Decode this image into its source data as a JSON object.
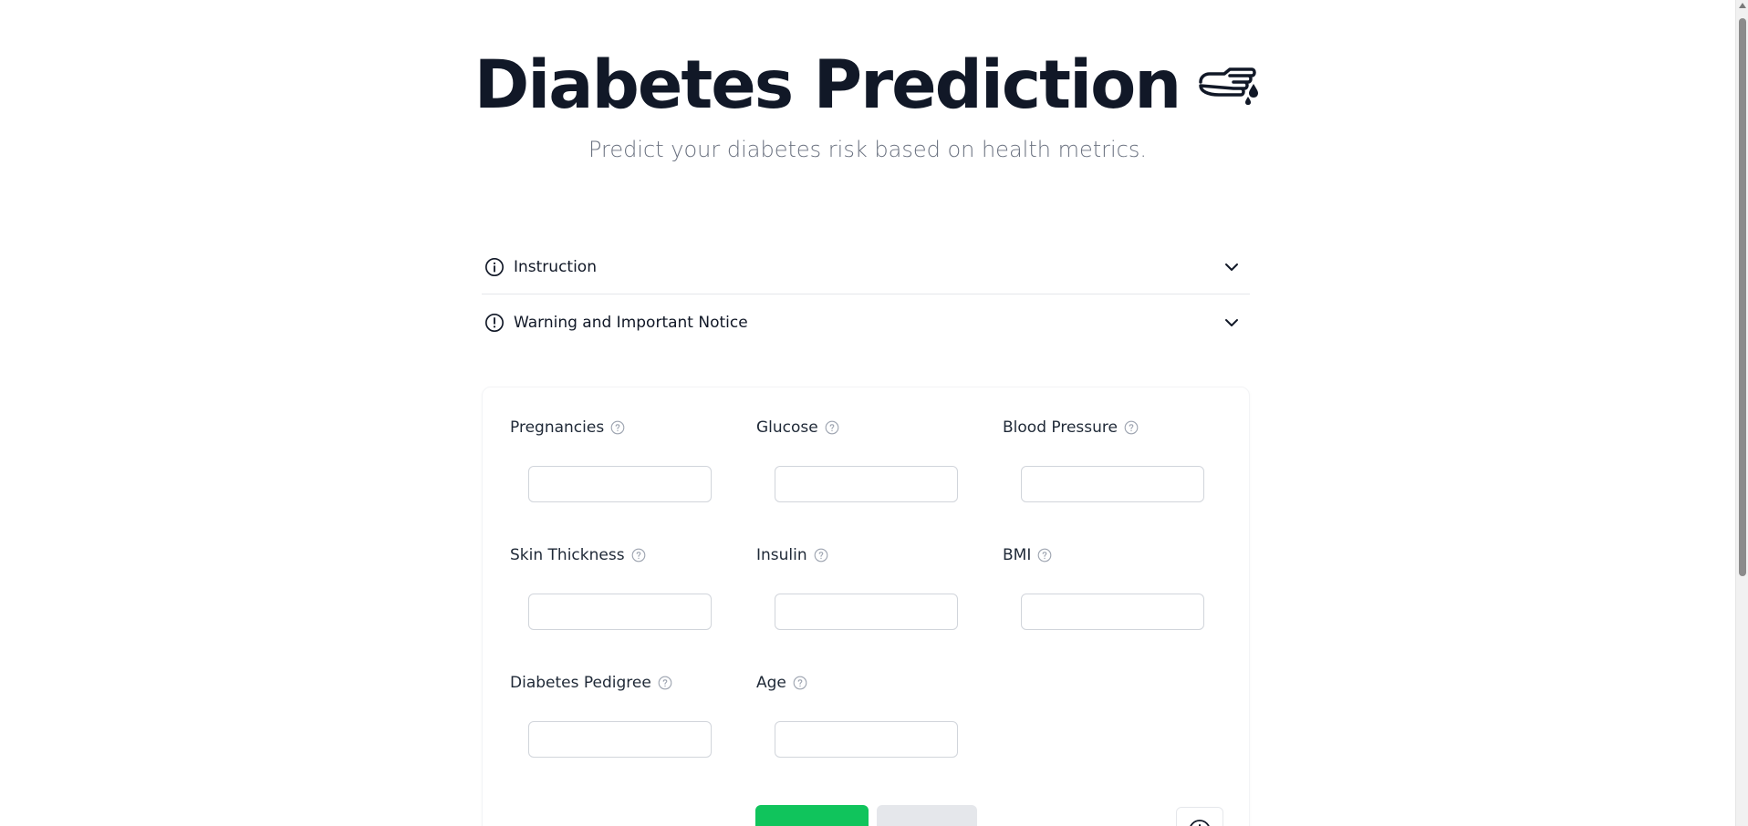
{
  "header": {
    "title": "Diabetes Prediction",
    "title_icon": "hand-pointing-blood-drop-icon",
    "subtitle": "Predict your diabetes risk based on health metrics."
  },
  "accordions": [
    {
      "label": "Instruction",
      "icon": "info-circle-icon",
      "expanded": false
    },
    {
      "label": "Warning and Important Notice",
      "icon": "alert-circle-icon",
      "expanded": false
    }
  ],
  "form": {
    "fields": [
      {
        "label": "Pregnancies",
        "value": "",
        "placeholder": ""
      },
      {
        "label": "Glucose",
        "value": "",
        "placeholder": ""
      },
      {
        "label": "Blood Pressure",
        "value": "",
        "placeholder": ""
      },
      {
        "label": "Skin Thickness",
        "value": "",
        "placeholder": ""
      },
      {
        "label": "Insulin",
        "value": "",
        "placeholder": ""
      },
      {
        "label": "BMI",
        "value": "",
        "placeholder": ""
      },
      {
        "label": "Diabetes Pedigree",
        "value": "",
        "placeholder": ""
      },
      {
        "label": "Age",
        "value": "",
        "placeholder": ""
      }
    ],
    "predict_label": "",
    "reset_label": ""
  },
  "colors": {
    "accent_green": "#10c45c",
    "title": "#111827",
    "subtitle": "#6b7280"
  }
}
